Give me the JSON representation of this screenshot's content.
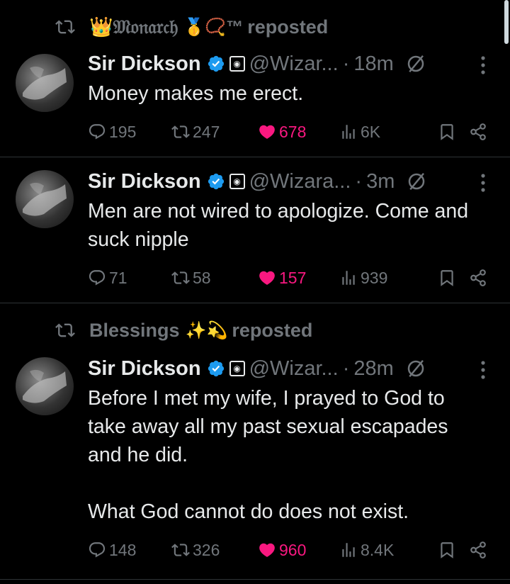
{
  "colors": {
    "background": "#000000",
    "text": "#e7e9ea",
    "muted": "#71767b",
    "like": "#f91880",
    "verified": "#1d9bf0",
    "divider": "#2f3336"
  },
  "tweets": [
    {
      "repost_by": "👑𝔐𝔬𝔫𝔞𝔯𝔠𝔥",
      "repost_emoji": "🥇📿™",
      "repost_label": "reposted",
      "author": "Sir Dickson",
      "handle": "@Wizar...",
      "time": "18m",
      "text": "Money makes me erect.",
      "replies": "195",
      "reposts": "247",
      "likes": "678",
      "views": "6K"
    },
    {
      "author": "Sir Dickson",
      "handle": "@Wizara...",
      "time": "3m",
      "text": "Men are not wired to apologize. Come and suck nipple",
      "replies": "71",
      "reposts": "58",
      "likes": "157",
      "views": "939"
    },
    {
      "repost_by": "Blessings",
      "repost_emoji": "✨💫",
      "repost_label": "reposted",
      "author": "Sir Dickson",
      "handle": "@Wizar...",
      "time": "28m",
      "text": "Before I met my wife, I prayed to God to take away all my past sexual escapades and he did.\n\nWhat God cannot do does not exist.",
      "replies": "148",
      "reposts": "326",
      "likes": "960",
      "views": "8.4K"
    }
  ]
}
